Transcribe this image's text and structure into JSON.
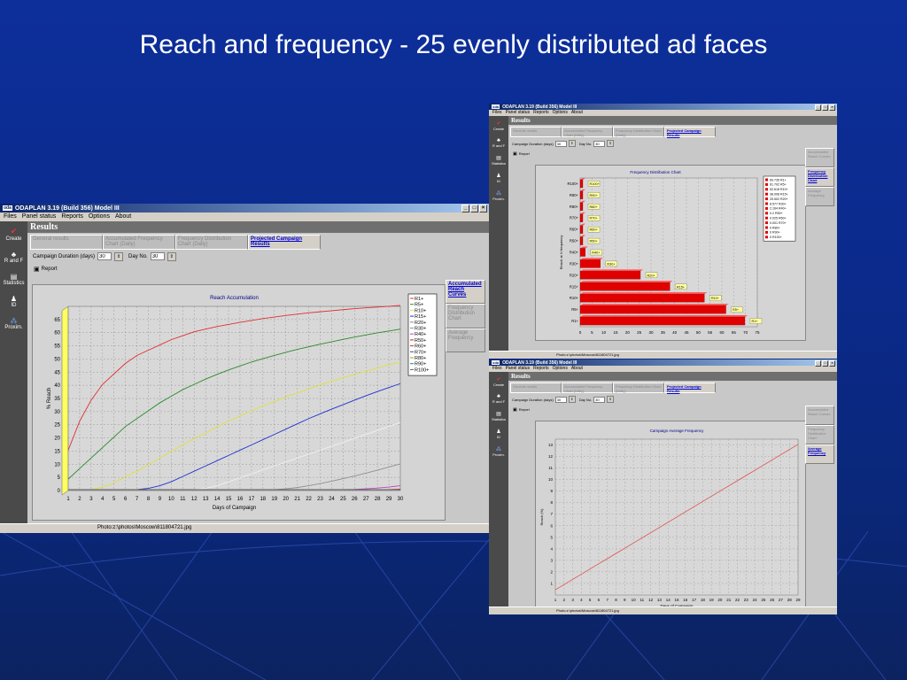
{
  "slide_title": "Reach and frequency - 25 evenly distributed ad faces",
  "app_title": "ODAPLAN 3.19  (Build 356)  Model III",
  "menu": [
    "Files",
    "Panel status",
    "Reports",
    "Options",
    "About"
  ],
  "toolbar": [
    "Create",
    "R and F",
    "Statistics",
    "ID",
    "Proxim."
  ],
  "results_label": "Results",
  "tabs": [
    "General results",
    "Accumulated Frequency Chart (Daily)",
    "Frequency Distribution Chart (Daily)",
    "Projected Campaign Results"
  ],
  "campaign_duration_label": "Campaign Duration (days)",
  "campaign_duration_value": "30",
  "day_no_label": "Day No.",
  "day_no_value": "30",
  "report_label": "Report",
  "status_text": "Photo:z:\\photos\\Moscow\\811804721.jpg",
  "windows": {
    "left": {
      "side_tabs": [
        "Accumulated Reach Curves",
        "Frequency Distribution Chart",
        "Average Frequency"
      ],
      "active_side_tab": 0
    },
    "top_right": {
      "side_tabs": [
        "Accumulated Reach Curves",
        "Frequency Distribution Chart",
        "Average Frequency"
      ],
      "active_side_tab": 1
    },
    "bottom_right": {
      "side_tabs": [
        "Accumulated Reach Curves",
        "Frequency Distribution Chart",
        "Average Frequency"
      ],
      "active_side_tab": 2
    }
  },
  "colors": {
    "bar": "#e00000",
    "line_accent": "#e06060"
  },
  "chart_data": [
    {
      "type": "line",
      "title": "Reach Accumulation",
      "xlabel": "Days of Campaign",
      "ylabel": "% Reach",
      "x": [
        1,
        2,
        3,
        4,
        5,
        6,
        7,
        8,
        9,
        10,
        11,
        12,
        13,
        14,
        15,
        16,
        17,
        18,
        19,
        20,
        21,
        22,
        23,
        24,
        25,
        26,
        27,
        28,
        29,
        30
      ],
      "ylim": [
        0,
        70
      ],
      "yticks": [
        0,
        5,
        10,
        15,
        20,
        25,
        30,
        35,
        40,
        45,
        50,
        55,
        60,
        65
      ],
      "grid": true,
      "legend_position": "top-right",
      "series": [
        {
          "name": "R1+",
          "color": "#e03030",
          "values": [
            15,
            26,
            34,
            40,
            44,
            48,
            51,
            53,
            55,
            57,
            58.5,
            60,
            61,
            62,
            62.8,
            63.6,
            64.3,
            65,
            65.6,
            66.2,
            66.7,
            67.2,
            67.6,
            68,
            68.4,
            68.8,
            69.1,
            69.4,
            69.7,
            70
          ]
        },
        {
          "name": "R5+",
          "color": "#2a8a2a",
          "values": [
            4,
            8,
            12,
            16,
            20,
            24,
            27,
            30,
            33,
            35.5,
            38,
            40,
            42,
            43.8,
            45.5,
            47,
            48.5,
            49.8,
            51,
            52.2,
            53.3,
            54.3,
            55.3,
            56.2,
            57.1,
            58,
            58.8,
            59.6,
            60.3,
            61
          ]
        },
        {
          "name": "R10+",
          "color": "#e0e040",
          "values": [
            0,
            0,
            0,
            1,
            2.5,
            5,
            7,
            9.5,
            12,
            14.5,
            17,
            19.5,
            21.5,
            24,
            26,
            28,
            30,
            31.8,
            33.5,
            35.2,
            36.8,
            38.3,
            39.8,
            41.2,
            42.5,
            43.8,
            45,
            46.2,
            47.4,
            48.5
          ]
        },
        {
          "name": "R15+",
          "color": "#2030d0",
          "values": [
            0,
            0,
            0,
            0,
            0,
            0,
            0,
            0.5,
            1.5,
            3,
            5,
            7,
            9,
            11,
            13,
            15,
            17,
            19,
            21,
            23,
            25,
            27,
            28.8,
            30.6,
            32.3,
            34,
            35.7,
            37.3,
            38.8,
            40.3
          ]
        },
        {
          "name": "R20+",
          "color": "#f0f0f0",
          "values": [
            0,
            0,
            0,
            0,
            0,
            0,
            0,
            0,
            0,
            0,
            0,
            0,
            0.5,
            1.5,
            3,
            4.5,
            6,
            7.5,
            9,
            10.5,
            12,
            13.5,
            15,
            16.5,
            18,
            19.5,
            21,
            22.5,
            24,
            25.5
          ]
        },
        {
          "name": "R30+",
          "color": "#909090",
          "values": [
            0,
            0,
            0,
            0,
            0,
            0,
            0,
            0,
            0,
            0,
            0,
            0,
            0,
            0,
            0,
            0,
            0,
            0,
            0,
            0.3,
            0.8,
            1.5,
            2.3,
            3.2,
            4.2,
            5.2,
            6.3,
            7.4,
            8.6,
            9.8
          ]
        },
        {
          "name": "R40+",
          "color": "#c040c0",
          "values": [
            0,
            0,
            0,
            0,
            0,
            0,
            0,
            0,
            0,
            0,
            0,
            0,
            0,
            0,
            0,
            0,
            0,
            0,
            0,
            0,
            0,
            0,
            0,
            0,
            0,
            0.1,
            0.3,
            0.6,
            1,
            1.5
          ]
        },
        {
          "name": "R50+",
          "color": "#d02020",
          "values": [
            0,
            0,
            0,
            0,
            0,
            0,
            0,
            0,
            0,
            0,
            0,
            0,
            0,
            0,
            0,
            0,
            0,
            0,
            0,
            0,
            0,
            0,
            0,
            0,
            0,
            0,
            0,
            0,
            0,
            0.2
          ]
        },
        {
          "name": "R60+",
          "color": "#a04020",
          "values": [
            0,
            0,
            0,
            0,
            0,
            0,
            0,
            0,
            0,
            0,
            0,
            0,
            0,
            0,
            0,
            0,
            0,
            0,
            0,
            0,
            0,
            0,
            0,
            0,
            0,
            0,
            0,
            0,
            0,
            0
          ]
        },
        {
          "name": "R70+",
          "color": "#4040c0",
          "values": [
            0,
            0,
            0,
            0,
            0,
            0,
            0,
            0,
            0,
            0,
            0,
            0,
            0,
            0,
            0,
            0,
            0,
            0,
            0,
            0,
            0,
            0,
            0,
            0,
            0,
            0,
            0,
            0,
            0,
            0
          ]
        },
        {
          "name": "R80+",
          "color": "#a0a000",
          "values": [
            0,
            0,
            0,
            0,
            0,
            0,
            0,
            0,
            0,
            0,
            0,
            0,
            0,
            0,
            0,
            0,
            0,
            0,
            0,
            0,
            0,
            0,
            0,
            0,
            0,
            0,
            0,
            0,
            0,
            0
          ]
        },
        {
          "name": "R90+",
          "color": "#208080",
          "values": [
            0,
            0,
            0,
            0,
            0,
            0,
            0,
            0,
            0,
            0,
            0,
            0,
            0,
            0,
            0,
            0,
            0,
            0,
            0,
            0,
            0,
            0,
            0,
            0,
            0,
            0,
            0,
            0,
            0,
            0
          ]
        },
        {
          "name": "R100+",
          "color": "#606060",
          "values": [
            0,
            0,
            0,
            0,
            0,
            0,
            0,
            0,
            0,
            0,
            0,
            0,
            0,
            0,
            0,
            0,
            0,
            0,
            0,
            0,
            0,
            0,
            0,
            0,
            0,
            0,
            0,
            0,
            0,
            0
          ]
        }
      ]
    },
    {
      "type": "bar",
      "orientation": "horizontal",
      "title": "Frequency Distribution Chart",
      "ylabel": "Reach at N frequency",
      "categories": [
        "R1+",
        "R5+",
        "R10+",
        "R15+",
        "R20+",
        "R30+",
        "R40+",
        "R50+",
        "R60+",
        "R70+",
        "R80+",
        "R90+",
        "R100+"
      ],
      "values": [
        69.735,
        61.702,
        52.618,
        38.008,
        25.502,
        8.577,
        2.164,
        0.2,
        0.025,
        0.001,
        0,
        0,
        0
      ],
      "bar_labels": [
        "R1+",
        "R5+",
        "R10+",
        "R15+",
        "R20+",
        "R30+",
        "R40+",
        "R50+",
        "R60+",
        "R70+",
        "R80+",
        "R90+",
        "R100+"
      ],
      "legend_entries": [
        "69.735 R1+",
        "61.702 R5+",
        "52.618 R10+",
        "38.008 R15+",
        "25.502 R20+",
        "8.577 R30+",
        "2.164 R40+",
        "0.2 R50+",
        "0.025 R60+",
        "0.001 R70+",
        "0 R80+",
        "0 R90+",
        "0 R100+"
      ],
      "xlim": [
        0,
        75
      ],
      "xticks": [
        0,
        5,
        10,
        15,
        20,
        25,
        30,
        35,
        40,
        45,
        50,
        55,
        60,
        65,
        70,
        75
      ],
      "legend_position": "top-right"
    },
    {
      "type": "line",
      "title": "Campaign Average Frequency",
      "xlabel": "Days of Campaign",
      "ylabel": "Reach (%)",
      "x": [
        1,
        2,
        3,
        4,
        5,
        6,
        7,
        8,
        9,
        10,
        11,
        12,
        13,
        14,
        15,
        16,
        17,
        18,
        19,
        20,
        21,
        22,
        23,
        24,
        25,
        26,
        27,
        28,
        29
      ],
      "values": [
        0.45,
        0.9,
        1.35,
        1.8,
        2.25,
        2.7,
        3.15,
        3.6,
        4.05,
        4.5,
        4.95,
        5.4,
        5.85,
        6.3,
        6.75,
        7.2,
        7.65,
        8.1,
        8.55,
        9,
        9.45,
        9.9,
        10.35,
        10.8,
        11.25,
        11.7,
        12.15,
        12.6,
        13.05
      ],
      "ylim": [
        0,
        13.5
      ],
      "yticks": [
        1,
        2,
        3,
        4,
        5,
        6,
        7,
        8,
        9,
        10,
        11,
        12,
        13
      ],
      "grid": true
    }
  ]
}
